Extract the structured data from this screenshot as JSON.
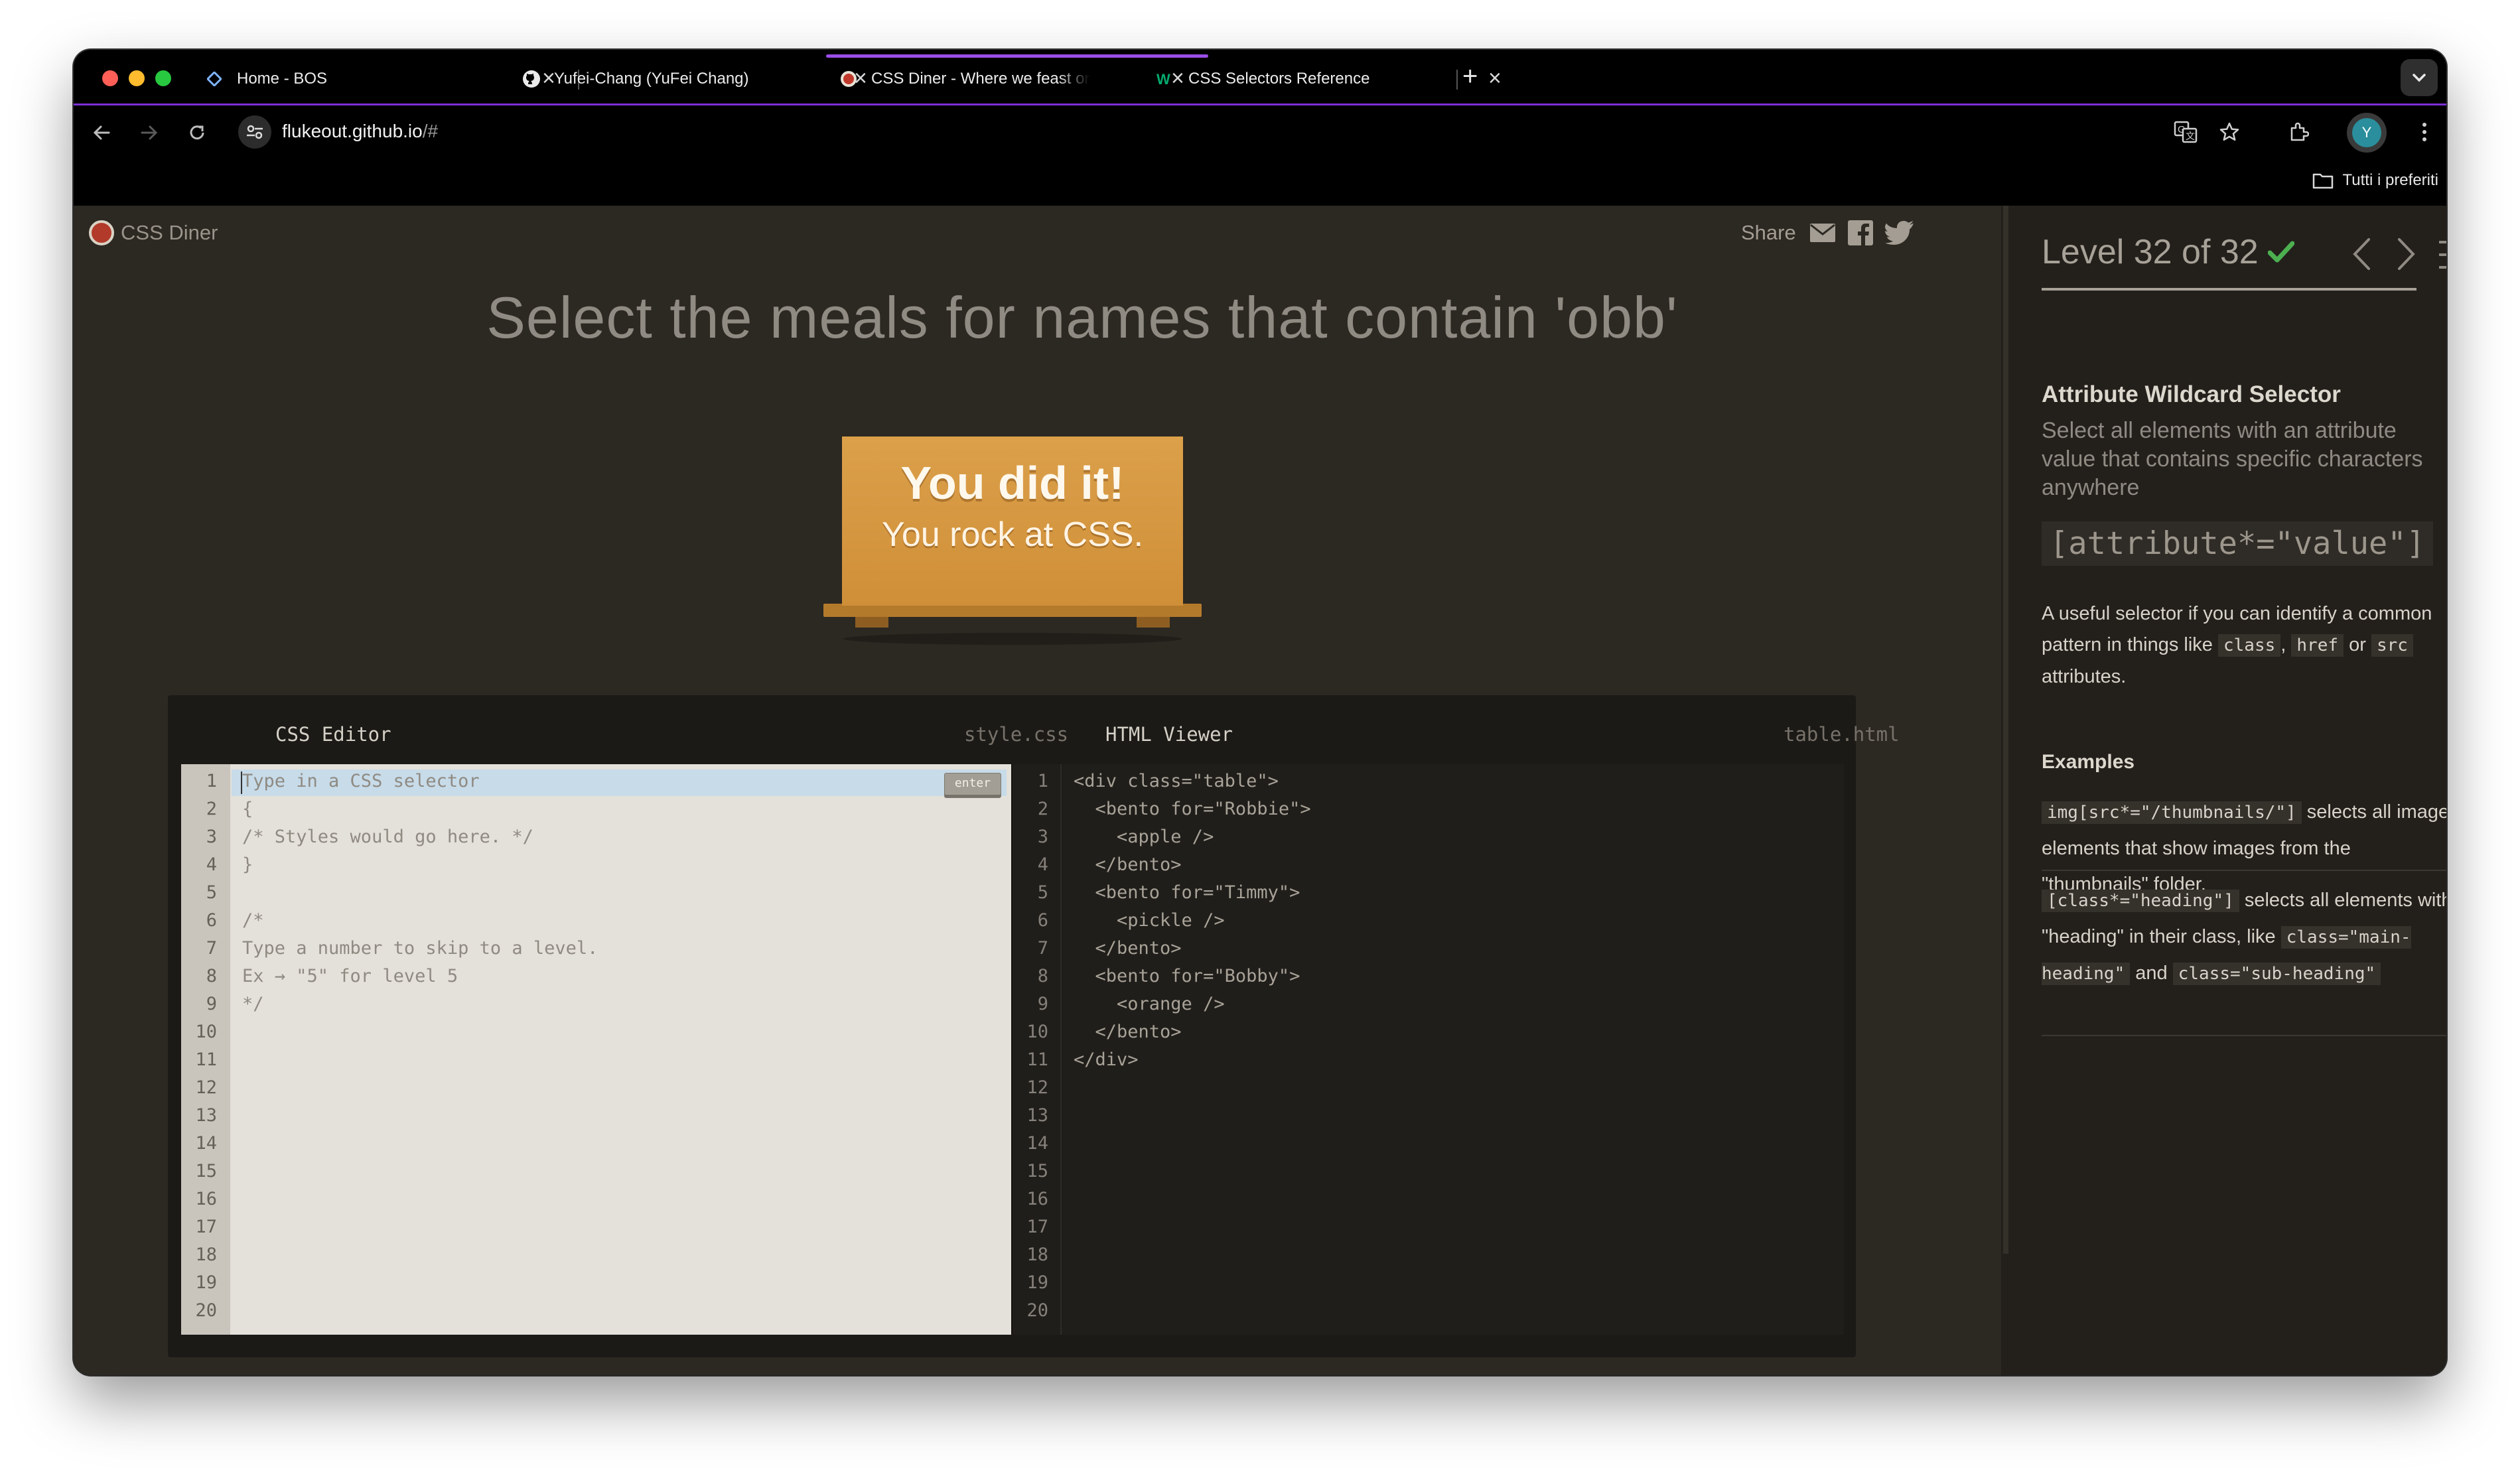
{
  "browser": {
    "tabs": [
      {
        "title": "Home - BOS",
        "icon": "bos-icon",
        "active": false
      },
      {
        "title": "Yufei-Chang (YuFei Chang)",
        "icon": "github-icon",
        "active": false
      },
      {
        "title": "CSS Diner - Where we feast on CSS",
        "icon": "css-diner-icon",
        "active": true
      },
      {
        "title": "CSS Selectors Reference",
        "icon": "w3schools-icon",
        "active": false
      }
    ],
    "new_tab": "+",
    "url_host": "flukeout.github.io",
    "url_path": "/#",
    "avatar_letter": "Y",
    "bookmarks_label": "Tutti i preferiti"
  },
  "game": {
    "brand": "CSS Diner",
    "share_label": "Share",
    "order": "Select the meals for names that contain 'obb'",
    "win_line1": "You did it!",
    "win_line2": "You rock at CSS.",
    "css_editor": {
      "title": "CSS Editor",
      "file": "style.css",
      "placeholder": "Type in a CSS selector",
      "enter_label": "enter",
      "lines": [
        "",
        "{",
        "/* Styles would go here. */",
        "}",
        "",
        "/*",
        "Type a number to skip to a level.",
        "Ex → \"5\" for level 5",
        "*/",
        "",
        "",
        "",
        "",
        "",
        "",
        "",
        "",
        "",
        "",
        ""
      ]
    },
    "html_viewer": {
      "title": "HTML Viewer",
      "file": "table.html",
      "lines": [
        "<div class=\"table\">",
        "  <bento for=\"Robbie\">",
        "    <apple />",
        "  </bento>",
        "  <bento for=\"Timmy\">",
        "    <pickle />",
        "  </bento>",
        "  <bento for=\"Bobby\">",
        "    <orange />",
        "  </bento>",
        "</div>",
        "",
        "",
        "",
        "",
        "",
        "",
        "",
        "",
        ""
      ]
    },
    "line_numbers": [
      "1",
      "2",
      "3",
      "4",
      "5",
      "6",
      "7",
      "8",
      "9",
      "10",
      "11",
      "12",
      "13",
      "14",
      "15",
      "16",
      "17",
      "18",
      "19",
      "20"
    ]
  },
  "sidebar": {
    "level_text": "Level 32 of 32",
    "level_done": true,
    "progress": 1.0,
    "selector_name": "Attribute Wildcard Selector",
    "selector_title": "Select all elements with an attribute value that contains specific characters anywhere",
    "syntax": "[attribute*=\"value\"]",
    "hint_parts": {
      "before": "A useful selector if you can identify a common pattern in things like",
      "code1": "class",
      "sep1": ",",
      "code2": "href",
      "mid": "or",
      "code3": "src",
      "after": "attributes."
    },
    "examples_label": "Examples",
    "example1": {
      "code": "img[src*=\"/thumbnails/\"]",
      "text": "selects all image elements that show images from the \"thumbnails\" folder."
    },
    "example2": {
      "code": "[class*=\"heading\"]",
      "text_a": "selects all elements with \"heading\" in their class, like",
      "code_b": "class=\"main-heading\"",
      "and": "and",
      "code_c": "class=\"sub-heading\""
    }
  },
  "colors": {
    "page_bg": "#2c2822",
    "accent_tab": "#9b4de8",
    "plate": "#dca04a",
    "check": "#4caf50"
  }
}
